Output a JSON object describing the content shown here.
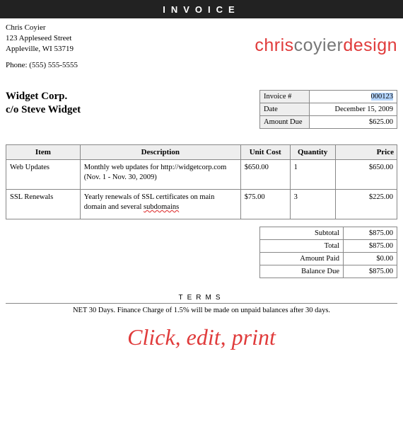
{
  "topbar": "INVOICE",
  "from": {
    "name": "Chris Coyier",
    "street": "123 Appleseed Street",
    "citystate": "Appleville, WI 53719",
    "phone": "Phone: (555) 555-5555"
  },
  "logo": {
    "part1": "chris",
    "part2": "coyier",
    "part3": "design"
  },
  "client": {
    "name": "Widget Corp.",
    "co": "c/o Steve Widget"
  },
  "meta": {
    "invoice_label": "Invoice #",
    "invoice_value": "000123",
    "date_label": "Date",
    "date_value": "December 15, 2009",
    "due_label": "Amount Due",
    "due_value": "$625.00"
  },
  "columns": {
    "item": "Item",
    "desc": "Description",
    "cost": "Unit Cost",
    "qty": "Quantity",
    "price": "Price"
  },
  "rows": [
    {
      "item": "Web Updates",
      "desc": "Monthly web updates for http://widgetcorp.com (Nov. 1 - Nov. 30, 2009)",
      "cost": "$650.00",
      "qty": "1",
      "price": "$650.00"
    },
    {
      "item": "SSL Renewals",
      "desc_a": "Yearly renewals of SSL certificates on main domain and several ",
      "desc_b": "subdomains",
      "cost": "$75.00",
      "qty": "3",
      "price": "$225.00"
    }
  ],
  "totals": {
    "subtotal_label": "Subtotal",
    "subtotal": "$875.00",
    "total_label": "Total",
    "total": "$875.00",
    "paid_label": "Amount Paid",
    "paid": "$0.00",
    "balance_label": "Balance Due",
    "balance": "$875.00"
  },
  "terms": {
    "heading": "TERMS",
    "body": "NET 30 Days. Finance Charge of 1.5% will be made on unpaid balances after 30 days."
  },
  "tagline": "Click, edit, print"
}
